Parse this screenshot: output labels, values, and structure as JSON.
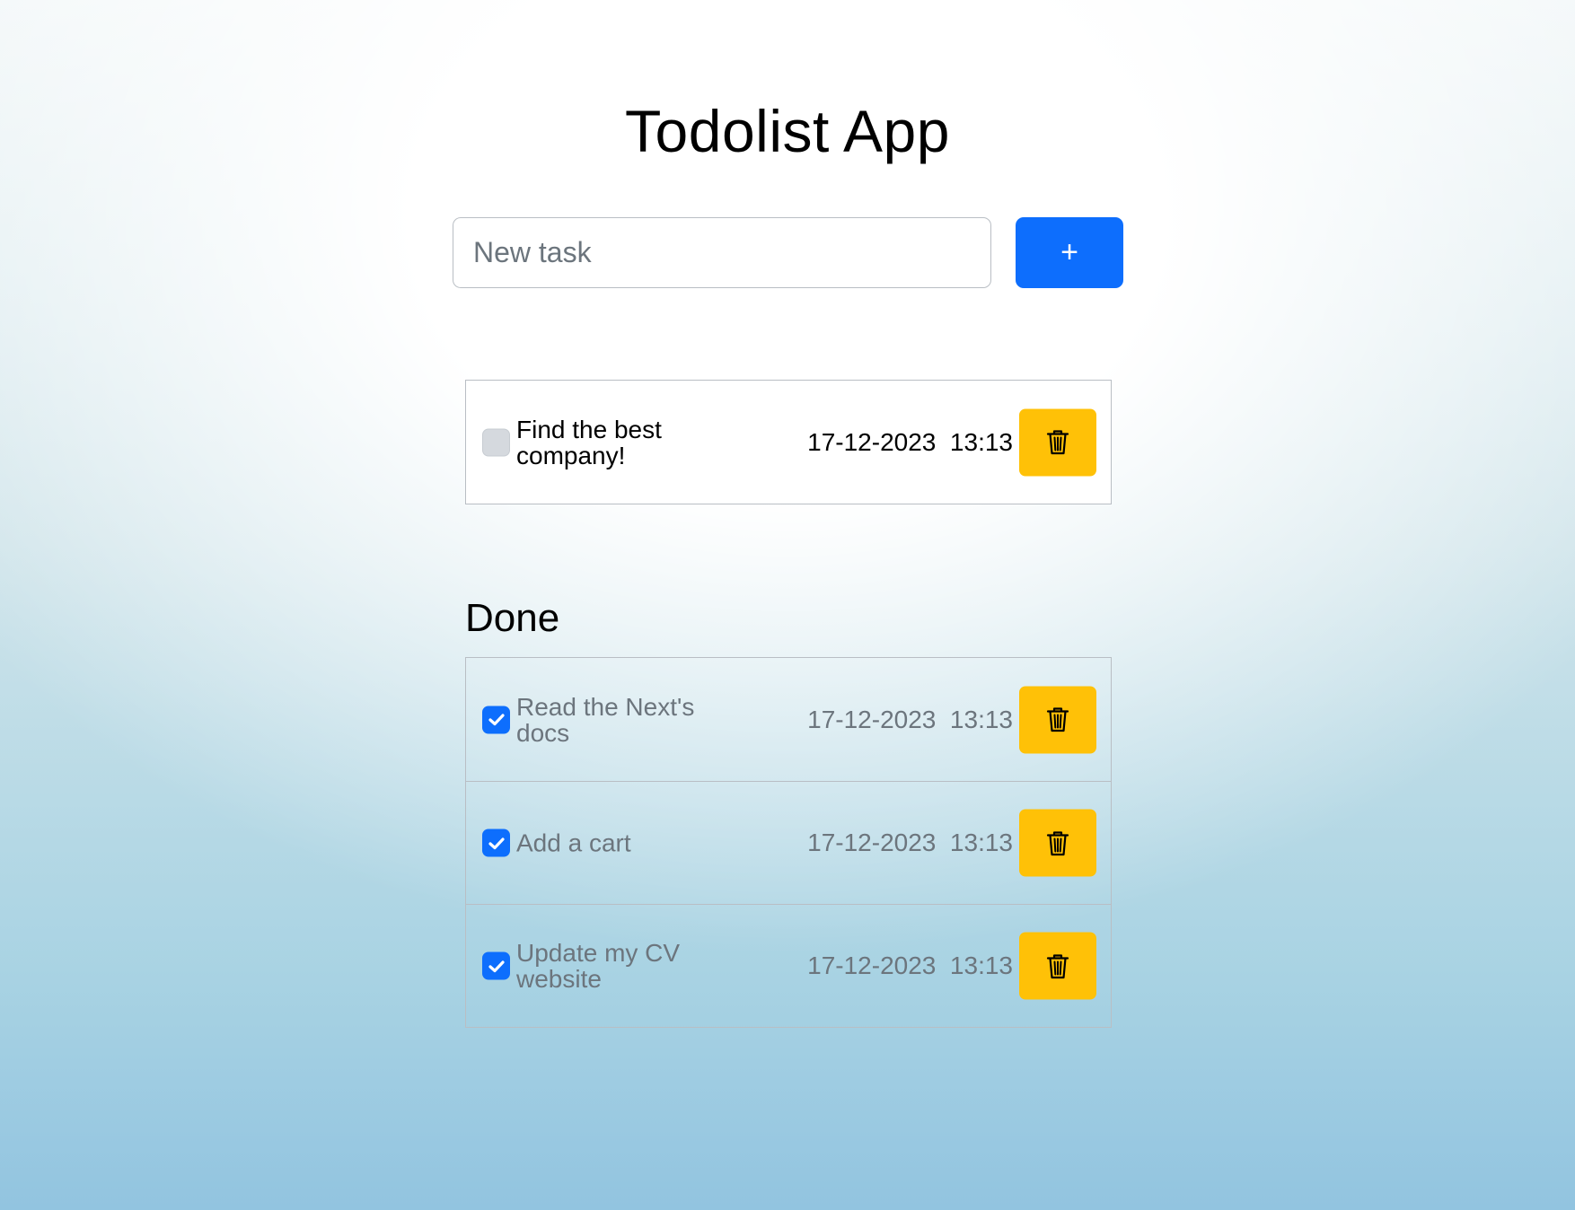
{
  "app": {
    "title": "Todolist App"
  },
  "new_task": {
    "placeholder": "New task",
    "value": "",
    "add_label": "+"
  },
  "pending_tasks": [
    {
      "label": "Find the best company!",
      "date": "17-12-2023",
      "time": "13:13",
      "done": false
    }
  ],
  "done_section": {
    "heading": "Done"
  },
  "done_tasks": [
    {
      "label": "Read the Next's docs",
      "date": "17-12-2023",
      "time": "13:13",
      "done": true
    },
    {
      "label": "Add a cart",
      "date": "17-12-2023",
      "time": "13:13",
      "done": true
    },
    {
      "label": "Update my CV website",
      "date": "17-12-2023",
      "time": "13:13",
      "done": true
    }
  ],
  "icons": {
    "delete": "trash-icon",
    "check": "check-icon"
  },
  "colors": {
    "primary": "#0d6efd",
    "warning": "#ffc107",
    "muted_text": "#6c757d"
  }
}
